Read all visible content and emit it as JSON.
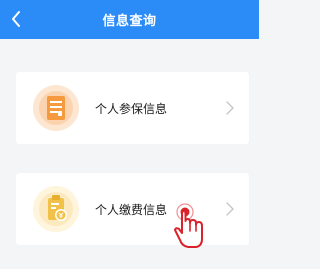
{
  "header": {
    "title": "信息查询",
    "back_icon": "chevron-left-icon",
    "background": "#2b8cf7"
  },
  "items": [
    {
      "label": "个人参保信息",
      "icon": "document-icon",
      "icon_color": "#f59a3e"
    },
    {
      "label": "个人缴费信息",
      "icon": "clipboard-yen-icon",
      "icon_color": "#f2c14a"
    }
  ],
  "pointer": {
    "icon": "tap-hand-icon",
    "accent": "#d9232a"
  }
}
